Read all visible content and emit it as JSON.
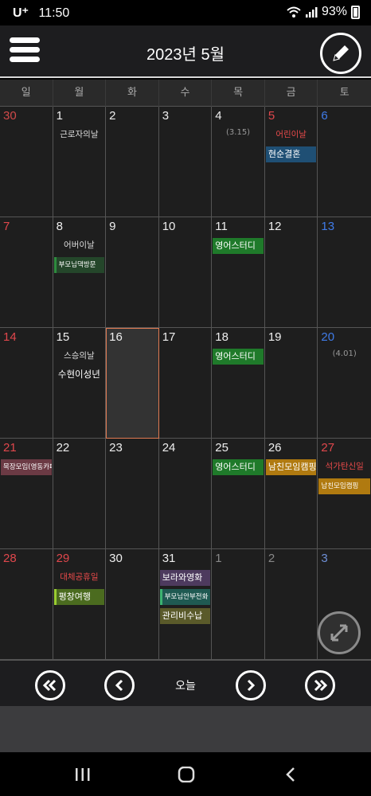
{
  "status": {
    "carrier": "U⁺",
    "time": "11:50",
    "battery": "93%"
  },
  "header": {
    "title": "2023년 5월"
  },
  "weekdays": [
    "일",
    "월",
    "화",
    "수",
    "목",
    "금",
    "토"
  ],
  "colors": {
    "sunday": "#e0474c",
    "saturday": "#3f7be8",
    "today_border": "#e07a52"
  },
  "calendar": {
    "days": [
      {
        "num": "30",
        "type": "sun dim"
      },
      {
        "num": "1",
        "note": "근로자의날"
      },
      {
        "num": "2"
      },
      {
        "num": "3"
      },
      {
        "num": "4",
        "lunar": "(3.15)"
      },
      {
        "num": "5",
        "type": "sun",
        "holiday": "어린이날",
        "events": [
          {
            "label": "현순결혼",
            "color": "#1f4f74",
            "row": 0
          }
        ]
      },
      {
        "num": "6",
        "type": "sat"
      },
      {
        "num": "7",
        "type": "sun"
      },
      {
        "num": "8",
        "note": "어버이날",
        "events": [
          {
            "label": "부모님댁방문",
            "color": "#24462a",
            "row": 0,
            "small": true,
            "bar": "#2e8b3e"
          }
        ]
      },
      {
        "num": "9"
      },
      {
        "num": "10"
      },
      {
        "num": "11",
        "events": [
          {
            "label": "영어스터디",
            "color": "#1f7a2a",
            "row": -1
          }
        ]
      },
      {
        "num": "12"
      },
      {
        "num": "13",
        "type": "sat"
      },
      {
        "num": "14",
        "type": "sun"
      },
      {
        "num": "15",
        "note": "스승의날",
        "text2": "수현이성년"
      },
      {
        "num": "16",
        "today": true
      },
      {
        "num": "17"
      },
      {
        "num": "18",
        "events": [
          {
            "label": "영어스터디",
            "color": "#1f7a2a",
            "row": -1
          }
        ]
      },
      {
        "num": "19"
      },
      {
        "num": "20",
        "type": "sat",
        "lunar": "(4.01)"
      },
      {
        "num": "21",
        "type": "sun",
        "events": [
          {
            "label": "목장모임(영동카페)",
            "color": "#6b3a44",
            "row": -1,
            "small": true
          }
        ]
      },
      {
        "num": "22"
      },
      {
        "num": "23"
      },
      {
        "num": "24"
      },
      {
        "num": "25",
        "events": [
          {
            "label": "영어스터디",
            "color": "#1f7a2a",
            "row": -1
          }
        ]
      },
      {
        "num": "26",
        "events": [
          {
            "label": "남친모임캠핑",
            "color": "#b07a10",
            "row": -1
          }
        ]
      },
      {
        "num": "27",
        "type": "sun",
        "holiday": "석가탄신일",
        "events": [
          {
            "label": "남친모임캠핑",
            "color": "#b07a10",
            "row": 0,
            "small": true
          }
        ]
      },
      {
        "num": "28",
        "type": "sun"
      },
      {
        "num": "29",
        "type": "sun",
        "holiday": "대체공휴일",
        "events": [
          {
            "label": "평창여행",
            "color": "#4b6b1f",
            "row": 0,
            "bar": "#9acd32"
          }
        ]
      },
      {
        "num": "30"
      },
      {
        "num": "31",
        "events": [
          {
            "label": "보라와영화",
            "color": "#4d3a5e",
            "row": -1
          },
          {
            "label": "부모님안부전화",
            "color": "#1f5a52",
            "row": 0,
            "small": true,
            "bar": "#3cb371"
          },
          {
            "label": "관리비수납",
            "color": "#5a5a2a",
            "row": 1
          }
        ]
      },
      {
        "num": "1",
        "type": "dim"
      },
      {
        "num": "2",
        "type": "dim"
      },
      {
        "num": "3",
        "type": "sat dim"
      }
    ]
  },
  "nav": {
    "today_label": "오늘"
  }
}
